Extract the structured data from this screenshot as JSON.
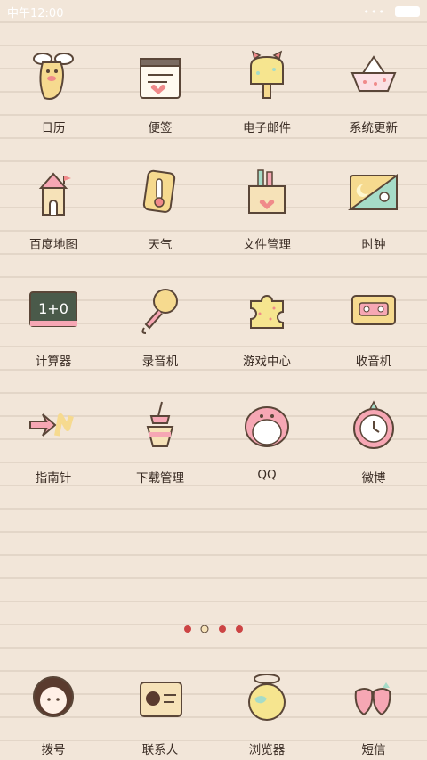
{
  "status_bar": {
    "time": "中午12:00",
    "signal": "•••"
  },
  "apps": [
    {
      "label": "日历",
      "icon": "calendar-icon"
    },
    {
      "label": "便签",
      "icon": "notepad-icon"
    },
    {
      "label": "电子邮件",
      "icon": "mailbox-icon"
    },
    {
      "label": "系统更新",
      "icon": "paper-boat-icon"
    },
    {
      "label": "百度地图",
      "icon": "castle-icon"
    },
    {
      "label": "天气",
      "icon": "thermometer-icon"
    },
    {
      "label": "文件管理",
      "icon": "pencil-box-icon"
    },
    {
      "label": "时钟",
      "icon": "day-night-icon"
    },
    {
      "label": "计算器",
      "icon": "calculator-icon"
    },
    {
      "label": "录音机",
      "icon": "microphone-icon"
    },
    {
      "label": "游戏中心",
      "icon": "puzzle-icon"
    },
    {
      "label": "收音机",
      "icon": "cassette-icon"
    },
    {
      "label": "指南针",
      "icon": "compass-arrow-icon"
    },
    {
      "label": "下载管理",
      "icon": "drink-cup-icon"
    },
    {
      "label": "QQ",
      "icon": "penguin-icon"
    },
    {
      "label": "微博",
      "icon": "strawberry-clock-icon"
    }
  ],
  "dock": [
    {
      "label": "拨号",
      "icon": "phone-girl-icon"
    },
    {
      "label": "联系人",
      "icon": "contact-card-icon"
    },
    {
      "label": "浏览器",
      "icon": "globe-halo-icon"
    },
    {
      "label": "短信",
      "icon": "strawberries-icon"
    }
  ]
}
